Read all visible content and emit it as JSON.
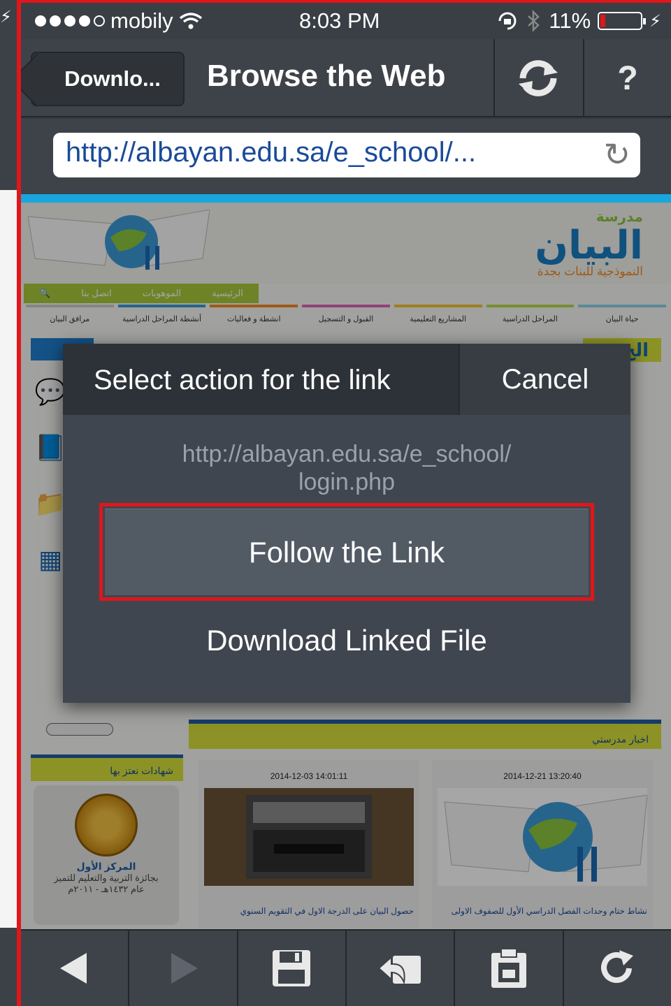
{
  "status_bar": {
    "carrier": "mobily",
    "time": "8:03 PM",
    "battery": "11%"
  },
  "nav": {
    "back_label": "Downlo...",
    "title": "Browse the Web",
    "help_label": "?"
  },
  "url_bar": {
    "url": "http://albayan.edu.sa/e_school/..."
  },
  "webpage": {
    "logo_small": "مدرسة",
    "logo_big": "البيان",
    "logo_sub": "النموذجية للبنات بجدة",
    "menu": [
      "الرئيسية",
      "الموهوبات",
      "اتصل بنا"
    ],
    "sections": [
      "حياة البيان",
      "المراحل الدراسية",
      "المشاريع التعليمية",
      "القبول و التسجيل",
      "انشطة و فعاليات",
      "أنشطة المراحل الدراسية",
      "مرافق البيان"
    ],
    "top_heading": "الج",
    "news_heading": "اخبار مدرستي",
    "cert_heading": "شهادات نعتز بها",
    "cert_title": "المركز الأول",
    "cert_text_1": "بجائزة التربية والتعليم للتميز",
    "cert_text_2": "عام ١٤٣٢هـ - ٢٠١١م",
    "news": [
      {
        "date": "2014-12-21 13:20:40",
        "caption": "نشاط ختام وحدات الفصل الدراسي الأول للصفوف الاولى"
      },
      {
        "date": "2014-12-03 14:01:11",
        "caption": "حصول البيان على الدرجة الاول في التقويم السنوي"
      }
    ]
  },
  "action_sheet": {
    "title": "Select action for the link",
    "cancel": "Cancel",
    "url_line1": "http://albayan.edu.sa/e_school/",
    "url_line2": "login.php",
    "follow": "Follow the Link",
    "download": "Download Linked File"
  },
  "toolbar": {
    "items": [
      "back-icon",
      "forward-icon",
      "save-icon",
      "share-icon",
      "clipboard-icon",
      "reload-icon"
    ]
  },
  "colors": {
    "accent_blue": "#18a6df",
    "highlight_red": "#e0161b",
    "web_yellow": "#d7e03a"
  }
}
